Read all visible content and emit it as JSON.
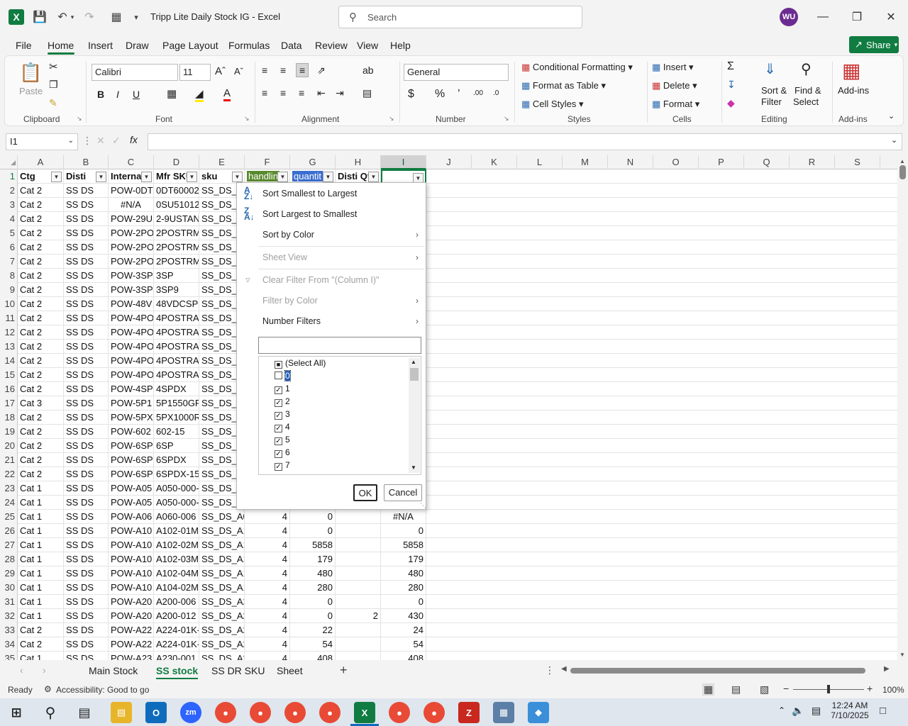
{
  "title_bar": {
    "doc_title": "Tripp Lite Daily Stock IG  -  Excel",
    "search_placeholder": "Search",
    "avatar": "WU"
  },
  "menu": {
    "tabs": [
      "File",
      "Home",
      "Insert",
      "Draw",
      "Page Layout",
      "Formulas",
      "Data",
      "Review",
      "View",
      "Help"
    ],
    "share": "Share"
  },
  "ribbon": {
    "clipboard": {
      "paste": "Paste",
      "label": "Clipboard"
    },
    "font": {
      "name": "Calibri",
      "size": "11",
      "label": "Font"
    },
    "alignment": {
      "label": "Alignment"
    },
    "number": {
      "format": "General",
      "label": "Number"
    },
    "styles": {
      "conditional": "Conditional Formatting",
      "table": "Format as Table",
      "cell": "Cell Styles",
      "label": "Styles"
    },
    "cells": {
      "insert": "Insert",
      "delete": "Delete",
      "format": "Format",
      "label": "Cells"
    },
    "editing": {
      "sort1": "Sort &",
      "sort2": "Filter",
      "find1": "Find &",
      "find2": "Select",
      "label": "Editing"
    },
    "addins": {
      "btn": "Add-ins",
      "label": "Add-ins"
    }
  },
  "formula_bar": {
    "name_box": "I1",
    "value": ""
  },
  "columns": [
    "A",
    "B",
    "C",
    "D",
    "E",
    "F",
    "G",
    "H",
    "I",
    "J",
    "K",
    "L",
    "M",
    "N",
    "O",
    "P",
    "Q",
    "R",
    "S"
  ],
  "header_row": [
    "Ctg",
    "Disti",
    "Interna",
    "Mfr SKU",
    "sku",
    "handlin",
    "quantit",
    "Disti Qt",
    ""
  ],
  "rows": [
    {
      "n": "2",
      "a": "Cat 2",
      "b": "SS DS",
      "c": "POW-0DT",
      "d": "0DT60002",
      "e": "SS_DS_0"
    },
    {
      "n": "3",
      "a": "Cat 2",
      "b": "SS DS",
      "c": "#N/A",
      "d": "0SU51012",
      "e": "SS_DS_0"
    },
    {
      "n": "4",
      "a": "Cat 2",
      "b": "SS DS",
      "c": "POW-29U",
      "d": "2-9USTAN",
      "e": "SS_DS_2"
    },
    {
      "n": "5",
      "a": "Cat 2",
      "b": "SS DS",
      "c": "POW-2PO",
      "d": "2POSTRMI",
      "e": "SS_DS_2"
    },
    {
      "n": "6",
      "a": "Cat 2",
      "b": "SS DS",
      "c": "POW-2PO",
      "d": "2POSTRMI",
      "e": "SS_DS_2"
    },
    {
      "n": "7",
      "a": "Cat 2",
      "b": "SS DS",
      "c": "POW-2PO",
      "d": "2POSTRMI",
      "e": "SS_DS_2"
    },
    {
      "n": "8",
      "a": "Cat 2",
      "b": "SS DS",
      "c": "POW-3SP",
      "d": "3SP",
      "e": "SS_DS_3"
    },
    {
      "n": "9",
      "a": "Cat 2",
      "b": "SS DS",
      "c": "POW-3SP",
      "d": "3SP9",
      "e": "SS_DS_3"
    },
    {
      "n": "10",
      "a": "Cat 2",
      "b": "SS DS",
      "c": "POW-48V",
      "d": "48VDCSPL",
      "e": "SS_DS_4"
    },
    {
      "n": "11",
      "a": "Cat 2",
      "b": "SS DS",
      "c": "POW-4PO",
      "d": "4POSTRAI",
      "e": "SS_DS_4"
    },
    {
      "n": "12",
      "a": "Cat 2",
      "b": "SS DS",
      "c": "POW-4PO",
      "d": "4POSTRAI",
      "e": "SS_DS_4"
    },
    {
      "n": "13",
      "a": "Cat 2",
      "b": "SS DS",
      "c": "POW-4PO",
      "d": "4POSTRAI",
      "e": "SS_DS_4"
    },
    {
      "n": "14",
      "a": "Cat 2",
      "b": "SS DS",
      "c": "POW-4PO",
      "d": "4POSTRAI",
      "e": "SS_DS_4"
    },
    {
      "n": "15",
      "a": "Cat 2",
      "b": "SS DS",
      "c": "POW-4PO",
      "d": "4POSTRAI",
      "e": "SS_DS_4"
    },
    {
      "n": "16",
      "a": "Cat 2",
      "b": "SS DS",
      "c": "POW-4SP",
      "d": "4SPDX",
      "e": "SS_DS_4"
    },
    {
      "n": "17",
      "a": "Cat 3",
      "b": "SS DS",
      "c": "POW-5P1",
      "d": "5P1550GR",
      "e": "SS_DS_5"
    },
    {
      "n": "18",
      "a": "Cat 2",
      "b": "SS DS",
      "c": "POW-5PX",
      "d": "5PX1000R",
      "e": "SS_DS_5"
    },
    {
      "n": "19",
      "a": "Cat 2",
      "b": "SS DS",
      "c": "POW-602",
      "d": "602-15",
      "e": "SS_DS_6"
    },
    {
      "n": "20",
      "a": "Cat 2",
      "b": "SS DS",
      "c": "POW-6SP",
      "d": "6SP",
      "e": "SS_DS_6"
    },
    {
      "n": "21",
      "a": "Cat 2",
      "b": "SS DS",
      "c": "POW-6SP",
      "d": "6SPDX",
      "e": "SS_DS_6"
    },
    {
      "n": "22",
      "a": "Cat 2",
      "b": "SS DS",
      "c": "POW-6SP",
      "d": "6SPDX-15",
      "e": "SS_DS_6"
    },
    {
      "n": "23",
      "a": "Cat 1",
      "b": "SS DS",
      "c": "POW-A05",
      "d": "A050-000-",
      "e": "SS_DS_A"
    },
    {
      "n": "24",
      "a": "Cat 1",
      "b": "SS DS",
      "c": "POW-A05",
      "d": "A050-000-",
      "e": "SS_DS_A"
    },
    {
      "n": "25",
      "a": "Cat 1",
      "b": "SS DS",
      "c": "POW-A06",
      "d": "A060-006",
      "e": "SS_DS_A0",
      "f": "4",
      "g": "0",
      "h": "",
      "i": "#N/A"
    },
    {
      "n": "26",
      "a": "Cat 1",
      "b": "SS DS",
      "c": "POW-A10",
      "d": "A102-01M",
      "e": "SS_DS_A1",
      "f": "4",
      "g": "0",
      "h": "",
      "i": "0"
    },
    {
      "n": "27",
      "a": "Cat 1",
      "b": "SS DS",
      "c": "POW-A10",
      "d": "A102-02M",
      "e": "SS_DS_A1",
      "f": "4",
      "g": "5858",
      "h": "",
      "i": "5858"
    },
    {
      "n": "28",
      "a": "Cat 1",
      "b": "SS DS",
      "c": "POW-A10",
      "d": "A102-03M",
      "e": "SS_DS_A1",
      "f": "4",
      "g": "179",
      "h": "",
      "i": "179"
    },
    {
      "n": "29",
      "a": "Cat 1",
      "b": "SS DS",
      "c": "POW-A10",
      "d": "A102-04M",
      "e": "SS_DS_A1",
      "f": "4",
      "g": "480",
      "h": "",
      "i": "480"
    },
    {
      "n": "30",
      "a": "Cat 1",
      "b": "SS DS",
      "c": "POW-A10",
      "d": "A104-02M",
      "e": "SS_DS_A1",
      "f": "4",
      "g": "280",
      "h": "",
      "i": "280"
    },
    {
      "n": "31",
      "a": "Cat 1",
      "b": "SS DS",
      "c": "POW-A20",
      "d": "A200-006",
      "e": "SS_DS_A2",
      "f": "4",
      "g": "0",
      "h": "",
      "i": "0"
    },
    {
      "n": "32",
      "a": "Cat 1",
      "b": "SS DS",
      "c": "POW-A20",
      "d": "A200-012",
      "e": "SS_DS_A2",
      "f": "4",
      "g": "0",
      "h": "2",
      "i": "430"
    },
    {
      "n": "33",
      "a": "Cat 2",
      "b": "SS DS",
      "c": "POW-A22",
      "d": "A224-01K-",
      "e": "SS_DS_A2",
      "f": "4",
      "g": "22",
      "h": "",
      "i": "24"
    },
    {
      "n": "34",
      "a": "Cat 2",
      "b": "SS DS",
      "c": "POW-A22",
      "d": "A224-01K-",
      "e": "SS_DS_A2",
      "f": "4",
      "g": "54",
      "h": "",
      "i": "54"
    },
    {
      "n": "35",
      "a": "Cat 1",
      "b": "SS DS",
      "c": "POW-A23",
      "d": "A230-001",
      "e": "SS_DS_A2",
      "f": "4",
      "g": "408",
      "h": "",
      "i": "408"
    }
  ],
  "filter_menu": {
    "sort_asc": "Sort Smallest to Largest",
    "sort_desc": "Sort Largest to Smallest",
    "sort_color": "Sort by Color",
    "sheet_view": "Sheet View",
    "clear_filter": "Clear Filter From \"(Column I)\"",
    "filter_color": "Filter by Color",
    "number_filters": "Number Filters",
    "items": [
      {
        "label": "(Select All)",
        "state": "partial"
      },
      {
        "label": "0",
        "state": "unchecked"
      },
      {
        "label": "1",
        "state": "checked"
      },
      {
        "label": "2",
        "state": "checked"
      },
      {
        "label": "3",
        "state": "checked"
      },
      {
        "label": "4",
        "state": "checked"
      },
      {
        "label": "5",
        "state": "checked"
      },
      {
        "label": "6",
        "state": "checked"
      },
      {
        "label": "7",
        "state": "checked"
      }
    ],
    "ok": "OK",
    "cancel": "Cancel"
  },
  "sheets": [
    "Main Stock",
    "SS stock",
    "SS DR SKU",
    "Sheet"
  ],
  "active_sheet": "SS stock",
  "status": {
    "ready": "Ready",
    "accessibility": "Accessibility: Good to go",
    "zoom": "100%"
  },
  "clock": {
    "time": "12:24 AM",
    "date": "7/10/2025"
  },
  "colors": {
    "excel_green": "#107c41",
    "filter_f": "#5a8a2e",
    "filter_g": "#3b6ed0"
  }
}
